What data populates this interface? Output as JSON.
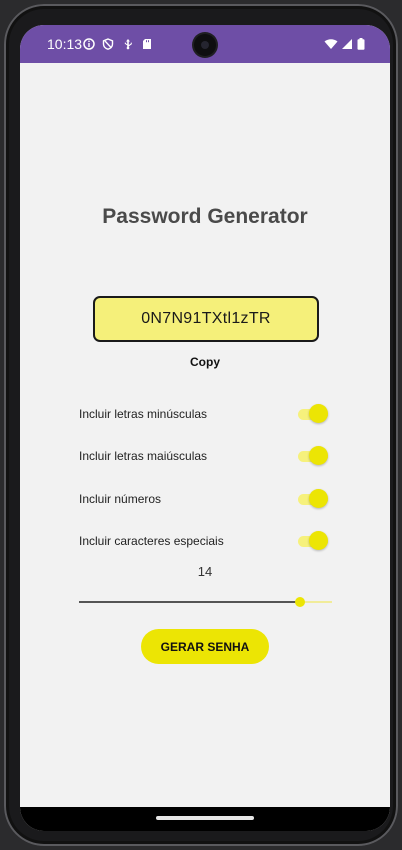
{
  "status_bar": {
    "time": "10:13",
    "icons": [
      "info-icon",
      "shield-icon",
      "usb-icon",
      "sd-card-icon",
      "wifi-icon",
      "signal-icon",
      "battery-icon"
    ]
  },
  "app": {
    "title": "Password Generator",
    "password": "0N7N91TXtl1zTR",
    "copy_label": "Copy",
    "options": [
      {
        "label": "Incluir letras minúsculas",
        "enabled": true
      },
      {
        "label": "Incluir letras maiúsculas",
        "enabled": true
      },
      {
        "label": "Incluir números",
        "enabled": true
      },
      {
        "label": "Incluir caracteres especiais",
        "enabled": true
      }
    ],
    "length": "14",
    "length_fraction": 0.875,
    "generate_label": "GERAR SENHA"
  },
  "colors": {
    "status_bar": "#6e4ea6",
    "accent": "#ece504",
    "password_bg": "#f5f07a",
    "background": "#f2f2f2"
  }
}
